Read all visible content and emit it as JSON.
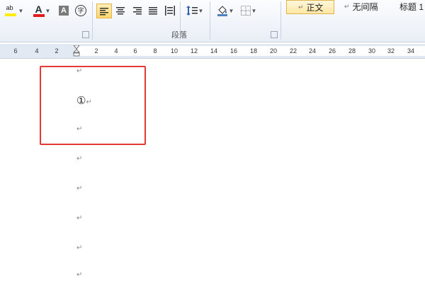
{
  "ribbon": {
    "groups": {
      "paragraph_label": "段落"
    },
    "tools": {
      "highlight_label": "ab",
      "font_color_label": "A",
      "char_shading_label": "A",
      "phonetic_label": "字"
    },
    "styles": [
      {
        "label": "正文",
        "mark": "↵",
        "selected": true
      },
      {
        "label": "无间隔",
        "mark": "↵",
        "selected": false
      },
      {
        "label": "标题 1",
        "mark": "",
        "selected": false
      }
    ]
  },
  "ruler": {
    "left_numbers": [
      "6",
      "4",
      "2"
    ],
    "right_numbers": [
      "2",
      "4",
      "6",
      "8",
      "10",
      "12",
      "14",
      "16",
      "18",
      "20",
      "22",
      "24",
      "26",
      "28",
      "30",
      "32",
      "34"
    ]
  },
  "document": {
    "paragraph_mark": "↵",
    "circled_char": "①"
  },
  "colors": {
    "highlight": "#e53935",
    "ribbon_bg": "#eef2f8",
    "style_selected": "#ffe7a4"
  }
}
